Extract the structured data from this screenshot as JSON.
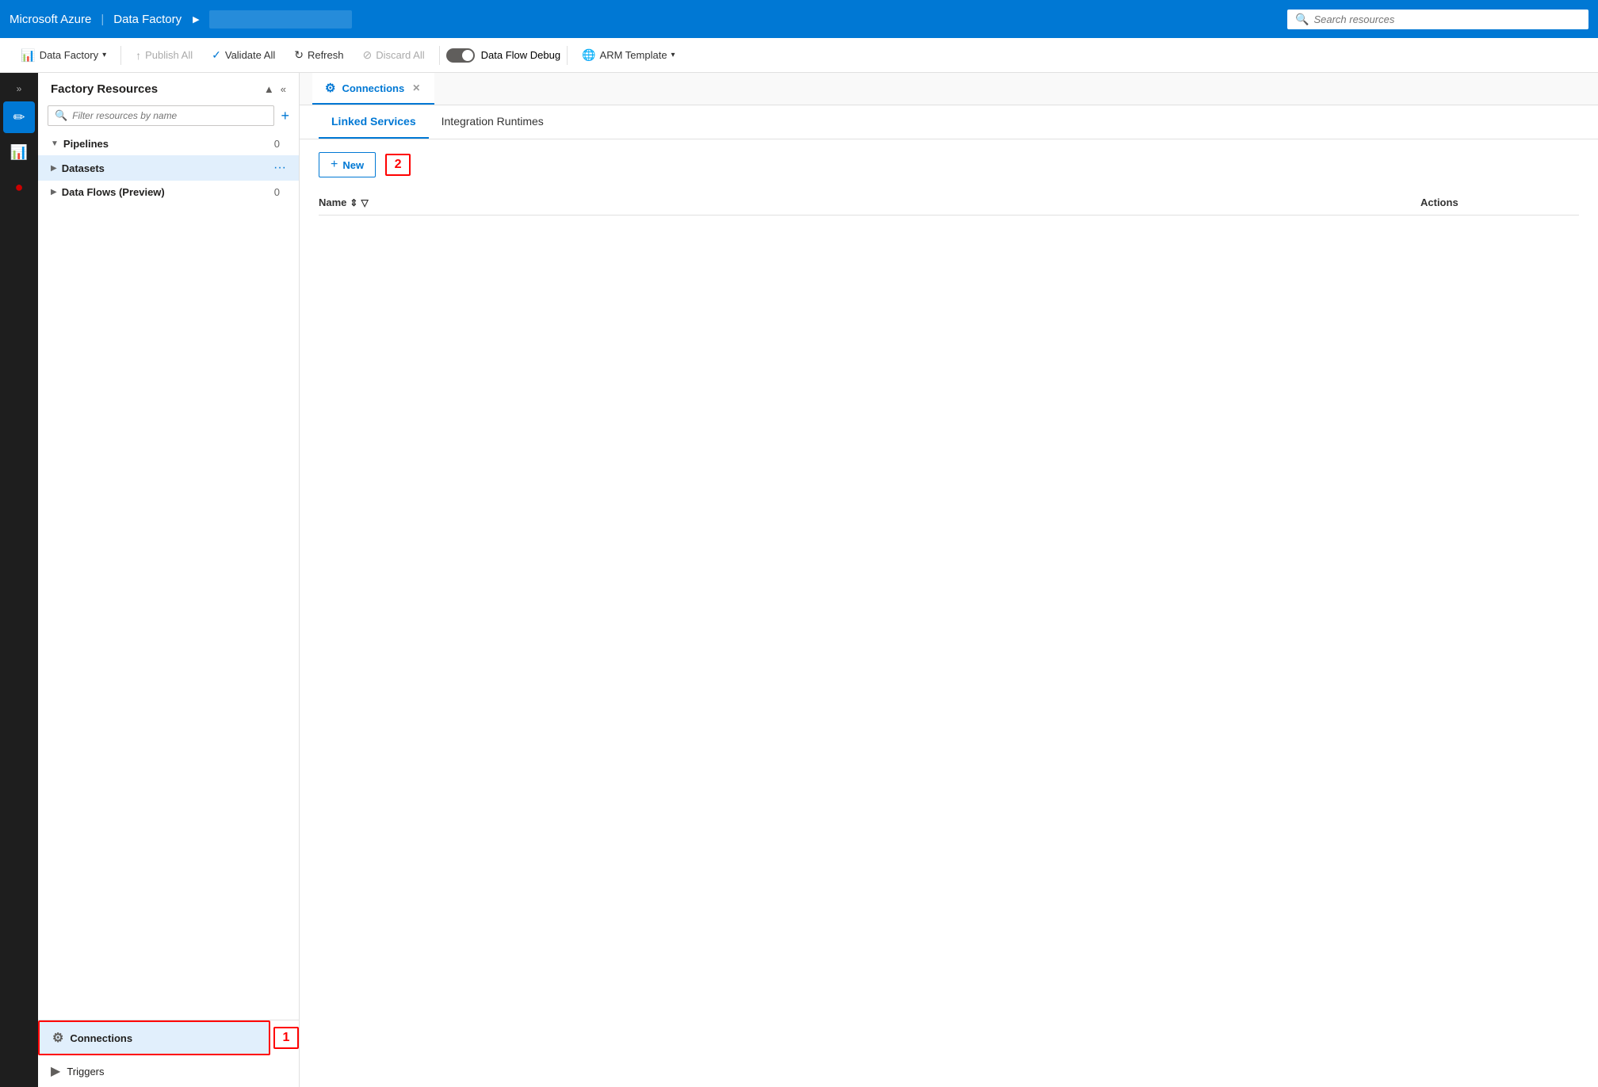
{
  "topNav": {
    "brand": "Microsoft Azure",
    "separator": "|",
    "app": "Data Factory",
    "arrow": "▶",
    "breadcrumb_placeholder": "",
    "search_placeholder": "Search resources"
  },
  "toolbar": {
    "dataFactory_label": "Data Factory",
    "publishAll_label": "Publish All",
    "validateAll_label": "Validate All",
    "refresh_label": "Refresh",
    "discardAll_label": "Discard All",
    "dataFlowDebug_label": "Data Flow Debug",
    "armTemplate_label": "ARM Template"
  },
  "sidebar": {
    "expand_icon": "»",
    "icons": [
      {
        "name": "pencil-icon",
        "symbol": "✏",
        "active": true
      },
      {
        "name": "pipeline-icon",
        "symbol": "📊",
        "active": false
      },
      {
        "name": "monitor-icon",
        "symbol": "🔴",
        "active": false
      }
    ]
  },
  "resourcesPanel": {
    "title": "Factory Resources",
    "collapse_icon": "▲",
    "collapse_icon2": "«",
    "search_placeholder": "Filter resources by name",
    "add_icon": "+",
    "tree": [
      {
        "label": "Pipelines",
        "count": "0",
        "expanded": true,
        "active": false
      },
      {
        "label": "Datasets",
        "count": "",
        "expanded": false,
        "active": true,
        "dots": "···"
      },
      {
        "label": "Data Flows (Preview)",
        "count": "0",
        "expanded": false,
        "active": false
      }
    ],
    "bottomItems": [
      {
        "label": "Connections",
        "icon": "⚙",
        "active": true
      },
      {
        "label": "Triggers",
        "icon": "▶",
        "active": false
      }
    ],
    "annotation1": "1"
  },
  "contentArea": {
    "tab": {
      "icon": "⚙",
      "label": "Connections",
      "close": "✕"
    },
    "subTabs": [
      {
        "label": "Linked Services",
        "active": true
      },
      {
        "label": "Integration Runtimes",
        "active": false
      }
    ],
    "newButton": "+ New",
    "annotation2": "2",
    "tableHeaders": {
      "name": "Name",
      "sort_icon": "⇕",
      "filter_icon": "▽",
      "actions": "Actions"
    }
  },
  "colors": {
    "azure_blue": "#0078d4",
    "nav_bg": "#1e1e1e",
    "top_nav_bg": "#0078d4",
    "active_tab_border": "#0078d4"
  }
}
